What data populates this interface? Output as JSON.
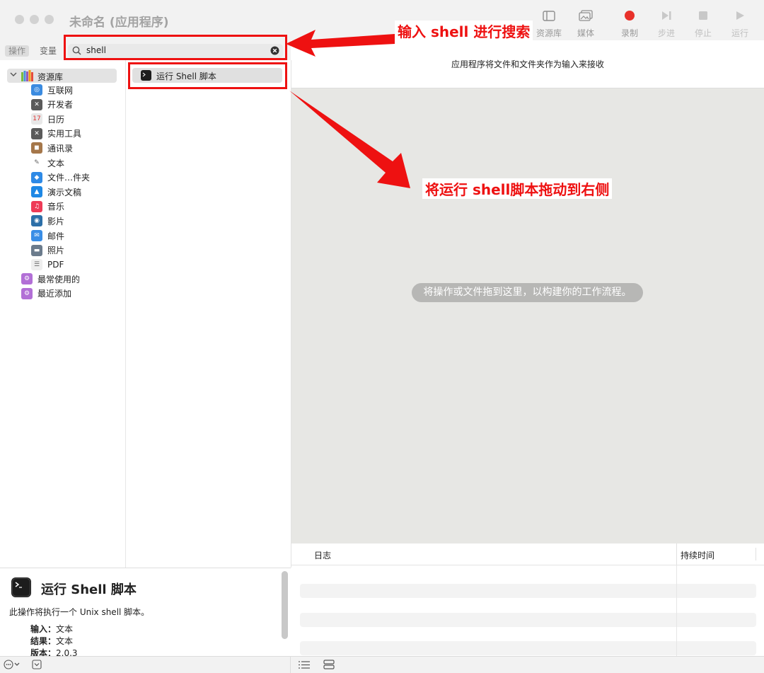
{
  "window": {
    "title": "未命名 (应用程序)"
  },
  "toolbar": {
    "library": "资源库",
    "media": "媒体",
    "record": "录制",
    "step": "步进",
    "stop": "停止",
    "run": "运行",
    "record_color": "#e8312a"
  },
  "tabs": {
    "actions": "操作",
    "variables": "变量"
  },
  "search": {
    "value": "shell"
  },
  "library": {
    "root": "资源库",
    "items": [
      "互联网",
      "开发者",
      "日历",
      "实用工具",
      "通讯录",
      "文本",
      "文件…件夹",
      "演示文稿",
      "音乐",
      "影片",
      "邮件",
      "照片",
      "PDF"
    ],
    "extra": [
      "最常使用的",
      "最近添加"
    ]
  },
  "actions": {
    "result": "运行 Shell 脚本"
  },
  "workflow": {
    "input_text": "应用程序将文件和文件夹作为输入来接收",
    "drop_hint": "将操作或文件拖到这里，以构建你的工作流程。"
  },
  "log": {
    "col_log": "日志",
    "col_duration": "持续时间"
  },
  "description": {
    "title": "运行 Shell 脚本",
    "body": "此操作将执行一个 Unix shell 脚本。",
    "input_label": "输入：",
    "input_value": "文本",
    "result_label": "结果：",
    "result_value": "文本",
    "version_label": "版本：",
    "version_value": "2.0.3"
  },
  "annotations": {
    "search_tip": "输入 shell 进行搜索",
    "drag_tip": "将运行 shell脚本拖动到右侧",
    "color": "#ee1111"
  },
  "icons": {
    "library": "sidebar-icon",
    "media": "photo-icon",
    "record": "record-dot-icon",
    "step": "step-forward-icon",
    "stop": "stop-square-icon",
    "run": "play-icon",
    "search": "magnifier-icon",
    "clear": "clear-x-icon",
    "terminal": "terminal-icon"
  }
}
